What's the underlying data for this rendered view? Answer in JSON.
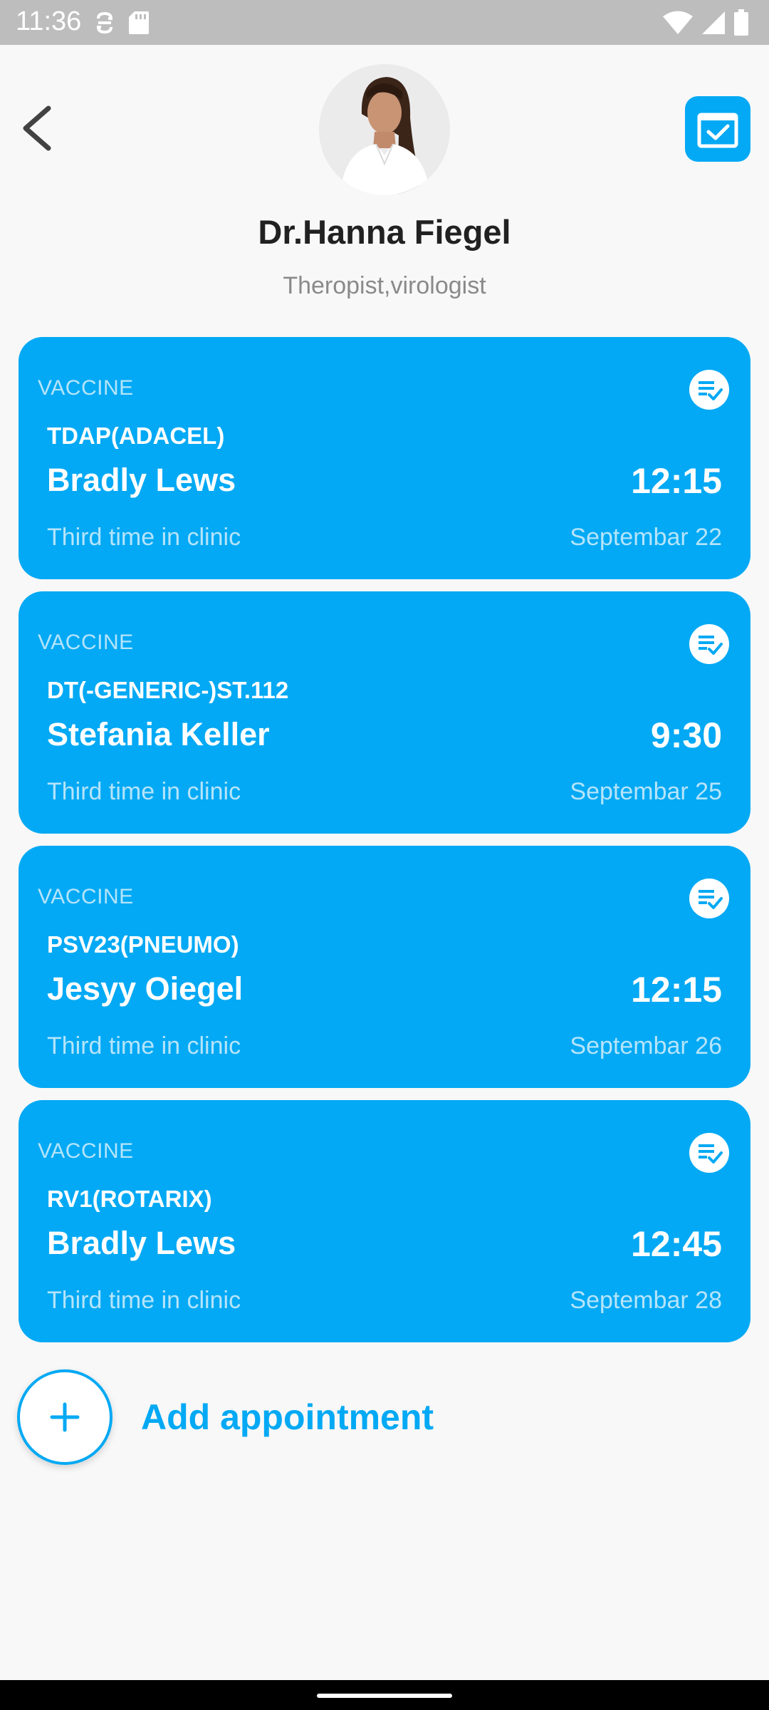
{
  "status_bar": {
    "time": "11:36",
    "icons": [
      "sync-icon",
      "sd-card-icon",
      "wifi-icon",
      "signal-icon",
      "battery-icon"
    ]
  },
  "header": {
    "back_icon": "chevron-left-icon",
    "calendar_icon": "calendar-check-icon",
    "doctor_name": "Dr.Hanna Fiegel",
    "specialty": "Theropist,virologist"
  },
  "appointments": [
    {
      "category": "VACCINE",
      "vaccine": "TDAP(ADACEL)",
      "patient": "Bradly Lews",
      "time": "12:15",
      "visit": "Third time in clinic",
      "date": "Septembar 22"
    },
    {
      "category": "VACCINE",
      "vaccine": "DT(-GENERIC-)ST.112",
      "patient": "Stefania Keller",
      "time": "9:30",
      "visit": "Third time in clinic",
      "date": "Septembar 25"
    },
    {
      "category": "VACCINE",
      "vaccine": "PSV23(PNEUMO)",
      "patient": "Jesyy Oiegel",
      "time": "12:15",
      "visit": "Third time in clinic",
      "date": "Septembar 26"
    },
    {
      "category": "VACCINE",
      "vaccine": "RV1(ROTARIX)",
      "patient": "Bradly Lews",
      "time": "12:45",
      "visit": "Third time in clinic",
      "date": "Septembar 28"
    }
  ],
  "add_appointment": {
    "label": "Add appointment",
    "icon": "plus-icon"
  },
  "colors": {
    "accent": "#03a9f4",
    "background": "#f8f8f8",
    "card_muted_text": "#b5e4fb"
  }
}
